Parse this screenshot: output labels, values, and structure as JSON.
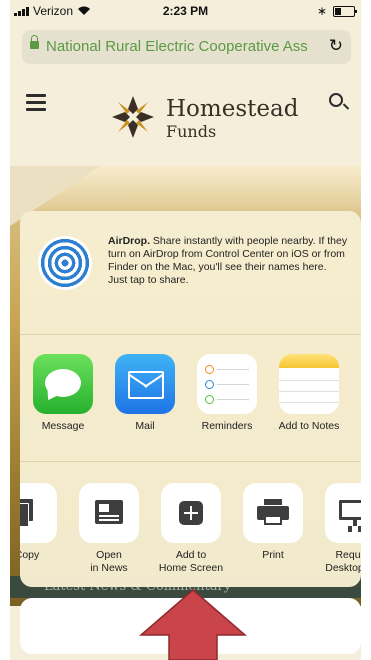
{
  "status": {
    "carrier": "Verizon",
    "time": "2:23 PM"
  },
  "browser": {
    "url_text": "National Rural Electric Cooperative Ass"
  },
  "site": {
    "logo_line1": "Homestead",
    "logo_line2": "Funds",
    "news_heading": "Latest News & Commentary"
  },
  "share_sheet": {
    "airdrop_title": "AirDrop.",
    "airdrop_body": " Share instantly with people nearby. If they turn on AirDrop from Control Center on iOS or from Finder on the Mac, you'll see their names here. Just tap to share.",
    "apps": [
      {
        "label": "Message",
        "icon": "messages-icon"
      },
      {
        "label": "Mail",
        "icon": "mail-icon"
      },
      {
        "label": "Reminders",
        "icon": "reminders-icon"
      },
      {
        "label": "Add to Notes",
        "icon": "notes-icon"
      }
    ],
    "actions": [
      {
        "label": "Copy",
        "icon": "copy-icon"
      },
      {
        "label": "Open\nin News",
        "icon": "news-icon"
      },
      {
        "label": "Add to\nHome Screen",
        "icon": "add-to-home-screen-icon"
      },
      {
        "label": "Print",
        "icon": "print-icon"
      },
      {
        "label": "Request\nDesktop Site",
        "icon": "desktop-icon"
      }
    ]
  },
  "colors": {
    "secure_green": "#5a9a43",
    "annotation_arrow": "#c9454a",
    "sheet_bg": "#f6eed2"
  }
}
